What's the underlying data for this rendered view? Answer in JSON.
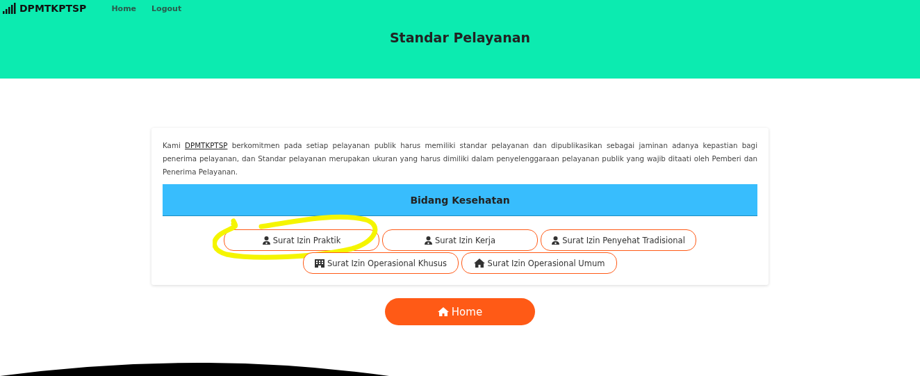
{
  "navbar": {
    "brand": "DPMTKPTSP",
    "links": [
      "Home",
      "Logout"
    ]
  },
  "page_title": "Standar Pelayanan",
  "intro": {
    "before": "Kami",
    "link": "DPMTKPTSP",
    "after": "berkomitmen pada setiap pelayanan publik harus memiliki standar pelayanan dan dipublikasikan sebagai jaminan adanya kepastian bagi penerima pelayanan, dan Standar pelayanan merupakan ukuran yang harus dimiliki dalam penyelenggaraan pelayanan publik yang wajib ditaati oleh Pemberi dan Penerima Pelayanan."
  },
  "section_title": "Bidang Kesehatan",
  "services": [
    {
      "label": "Surat Izin Praktik",
      "kind": "person",
      "highlighted": true
    },
    {
      "label": "Surat Izin Kerja",
      "kind": "person",
      "highlighted": false
    },
    {
      "label": "Surat Izin Penyehat Tradisional",
      "kind": "person",
      "highlighted": false
    },
    {
      "label": "Surat Izin Operasional Khusus",
      "kind": "building",
      "highlighted": false
    },
    {
      "label": "Surat Izin Operasional Umum",
      "kind": "house",
      "highlighted": false
    }
  ],
  "home_button": "Home"
}
